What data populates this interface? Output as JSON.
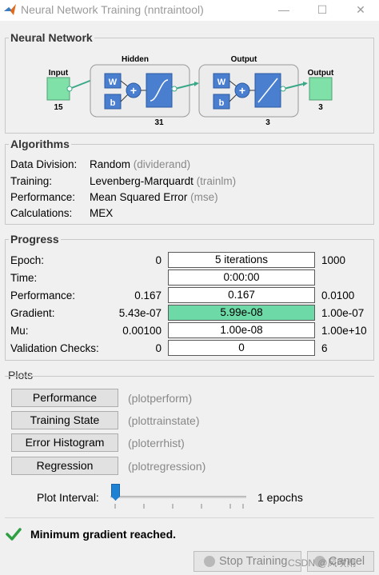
{
  "window": {
    "title": "Neural Network Training (nntraintool)"
  },
  "network": {
    "title": "Neural Network",
    "input_label": "Input",
    "input_size": "15",
    "hidden_label": "Hidden",
    "hidden_size": "31",
    "output_layer_label": "Output",
    "output_layer_size": "3",
    "output_label": "Output",
    "output_size": "3",
    "w_label": "W",
    "b_label": "b"
  },
  "algorithms": {
    "title": "Algorithms",
    "rows": [
      {
        "label": "Data Division:",
        "value": "Random",
        "fn": "(dividerand)"
      },
      {
        "label": "Training:",
        "value": "Levenberg-Marquardt",
        "fn": "(trainlm)"
      },
      {
        "label": "Performance:",
        "value": "Mean Squared Error",
        "fn": "(mse)"
      },
      {
        "label": "Calculations:",
        "value": "MEX",
        "fn": ""
      }
    ]
  },
  "progress": {
    "title": "Progress",
    "rows": [
      {
        "label": "Epoch:",
        "min": "0",
        "current": "5 iterations",
        "max": "1000"
      },
      {
        "label": "Time:",
        "min": "",
        "current": "0:00:00",
        "max": ""
      },
      {
        "label": "Performance:",
        "min": "0.167",
        "current": "0.167",
        "max": "0.0100"
      },
      {
        "label": "Gradient:",
        "min": "5.43e-07",
        "current": "5.99e-08",
        "max": "1.00e-07"
      },
      {
        "label": "Mu:",
        "min": "0.00100",
        "current": "1.00e-08",
        "max": "1.00e+10"
      },
      {
        "label": "Validation Checks:",
        "min": "0",
        "current": "0",
        "max": "6"
      }
    ],
    "highlight_color": "#6dd9a6"
  },
  "plots": {
    "title": "Plots",
    "buttons": [
      {
        "label": "Performance",
        "fn": "(plotperform)"
      },
      {
        "label": "Training State",
        "fn": "(plottrainstate)"
      },
      {
        "label": "Error Histogram",
        "fn": "(ploterrhist)"
      },
      {
        "label": "Regression",
        "fn": "(plotregression)"
      }
    ],
    "interval_label": "Plot Interval:",
    "interval_value": "1 epochs"
  },
  "status": {
    "message": "Minimum gradient reached."
  },
  "footer": {
    "stop_label": "Stop Training",
    "cancel_label": "Cancel"
  },
  "watermark": "CSDN @风吹雨"
}
